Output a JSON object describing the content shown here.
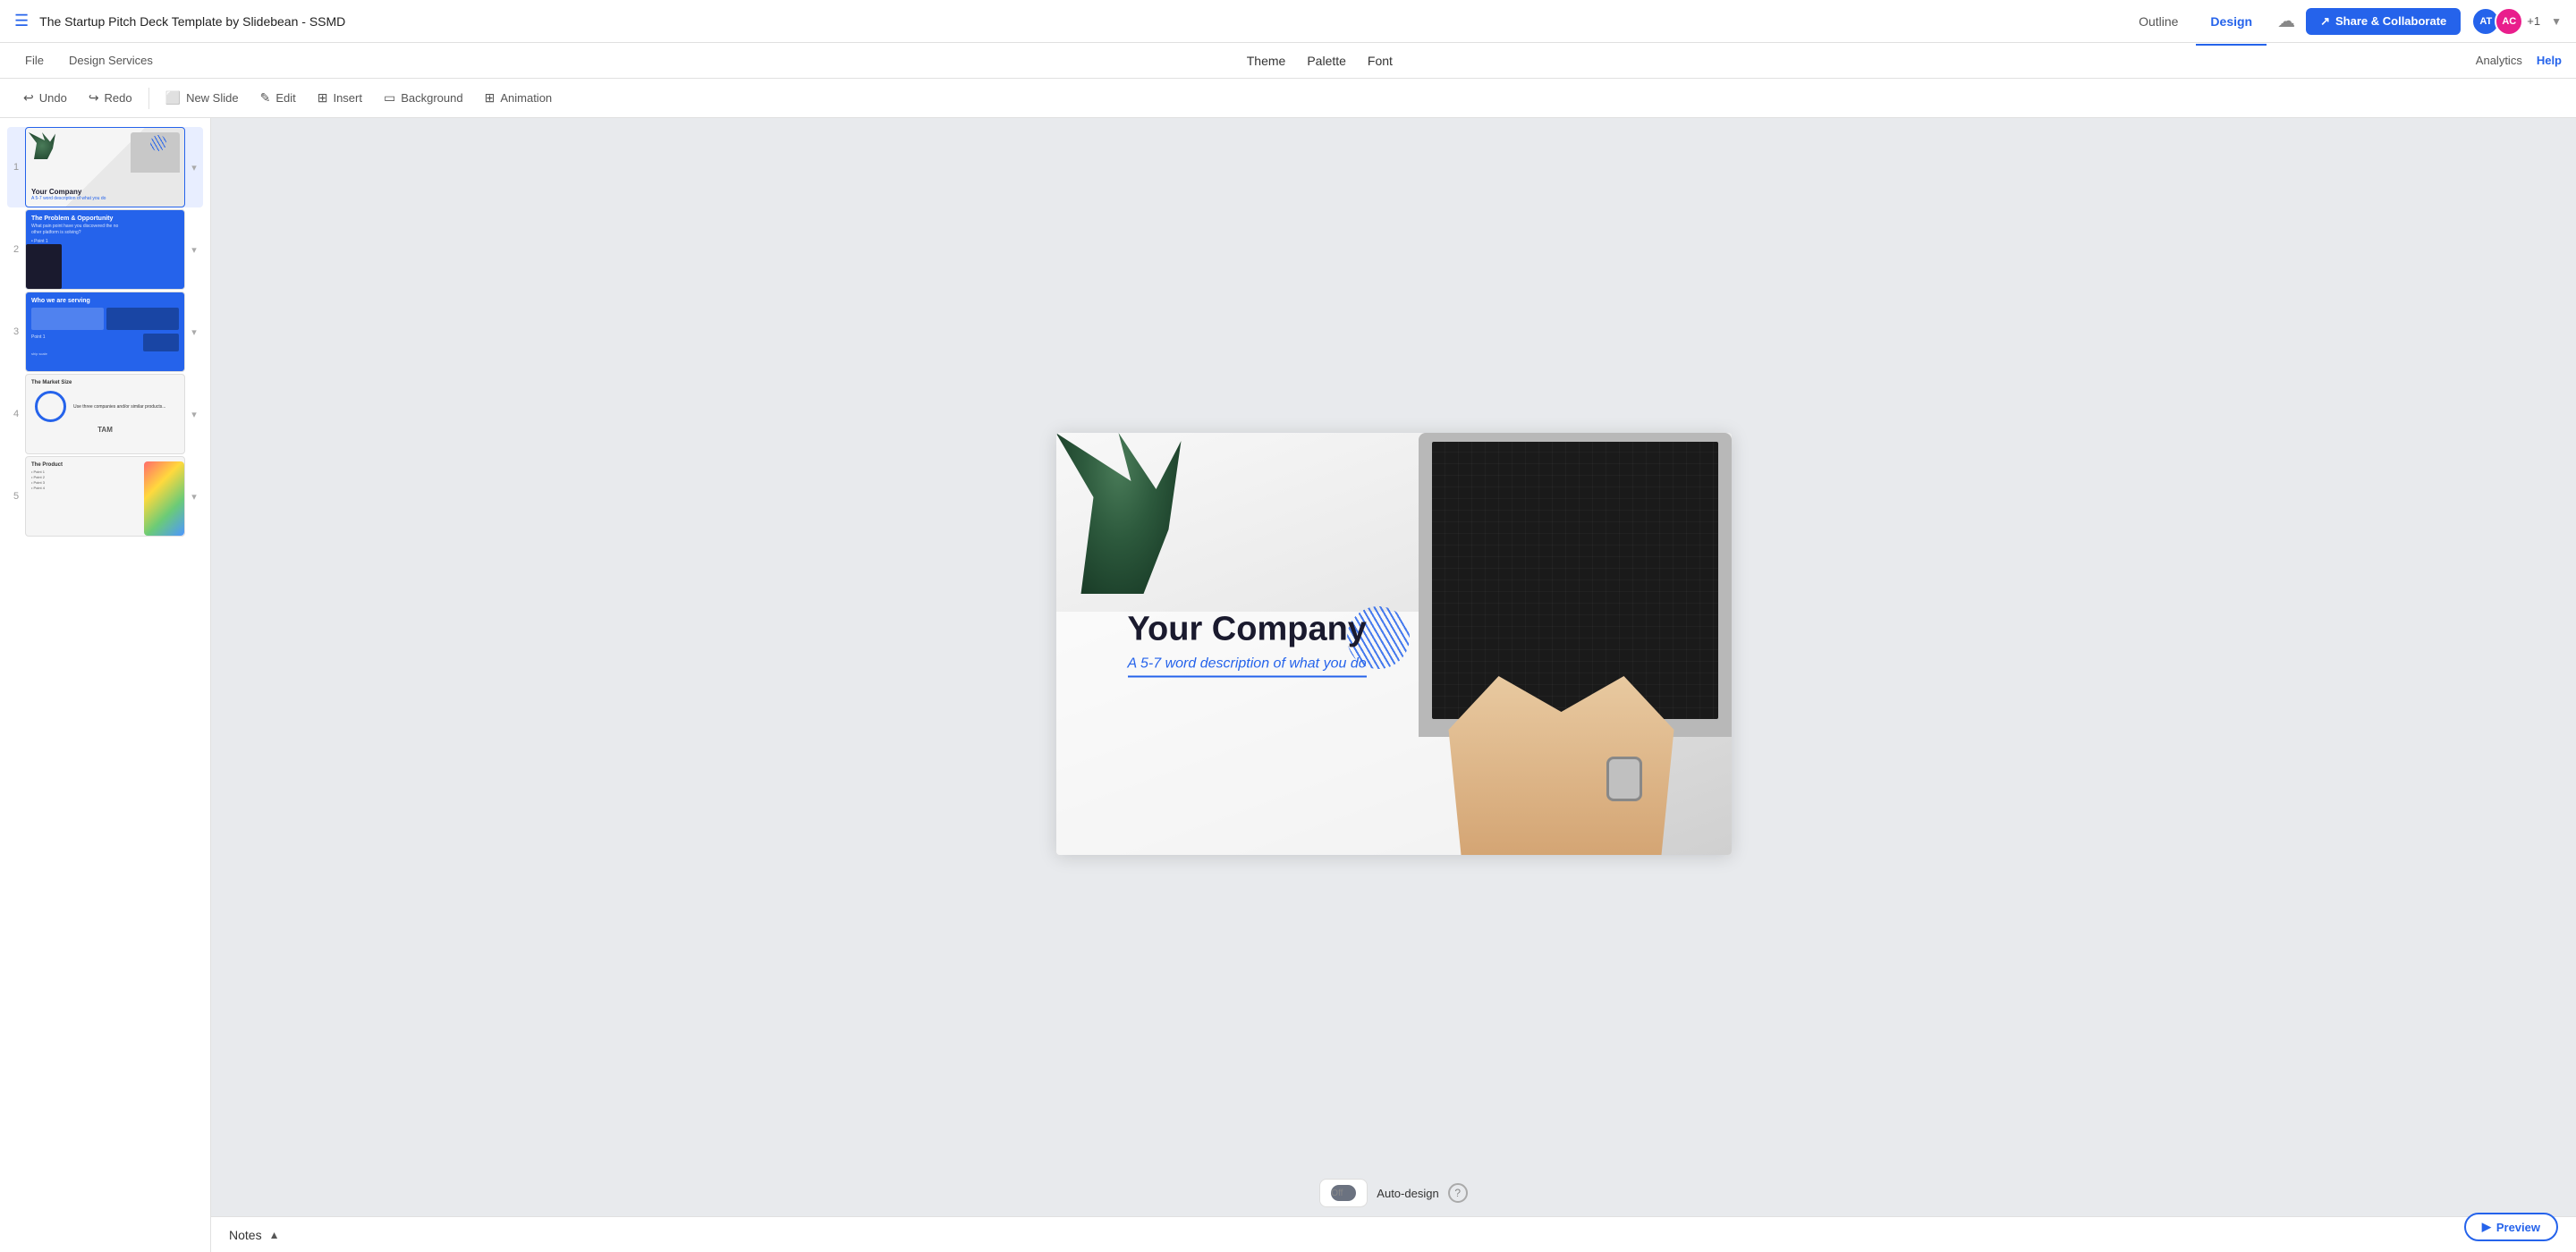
{
  "app": {
    "title": "The Startup Pitch Deck Template by Slidebean - SSMD",
    "hamburger": "☰"
  },
  "nav": {
    "outline_label": "Outline",
    "design_label": "Design",
    "active_tab": "Design"
  },
  "nav_right": {
    "cloud_icon": "☁",
    "share_label": "Share & Collaborate",
    "avatar_initials": "AT",
    "avatar2_initials": "AC",
    "extra_count": "+1",
    "dropdown_arrow": "▼"
  },
  "second_bar": {
    "file_label": "File",
    "design_services_label": "Design Services",
    "theme_label": "Theme",
    "palette_label": "Palette",
    "font_label": "Font",
    "analytics_label": "Analytics",
    "help_label": "Help"
  },
  "toolbar": {
    "undo_label": "Undo",
    "redo_label": "Redo",
    "new_slide_label": "New Slide",
    "edit_label": "Edit",
    "insert_label": "Insert",
    "background_label": "Background",
    "animation_label": "Animation"
  },
  "slides": [
    {
      "num": "1",
      "title": "Your Company",
      "subtitle": "A 5-7 word description of what you do",
      "active": true
    },
    {
      "num": "2",
      "title": "The Problem & Opportunity",
      "subtitle": "What pain point have you discovered the no other platform is solving?"
    },
    {
      "num": "3",
      "title": "Who we are serving ship scale",
      "subtitle": ""
    },
    {
      "num": "4",
      "title": "The Market Size",
      "subtitle": "TAM"
    },
    {
      "num": "5",
      "title": "The Product",
      "subtitle": ""
    }
  ],
  "canvas": {
    "company_title": "Your Company",
    "description": "A 5-7 word description of what you do"
  },
  "auto_design": {
    "toggle_label": "Off",
    "label": "Auto-design",
    "help_icon": "?"
  },
  "notes": {
    "label": "Notes",
    "chevron": "▲"
  },
  "preview": {
    "label": "Preview",
    "icon": "▶"
  }
}
